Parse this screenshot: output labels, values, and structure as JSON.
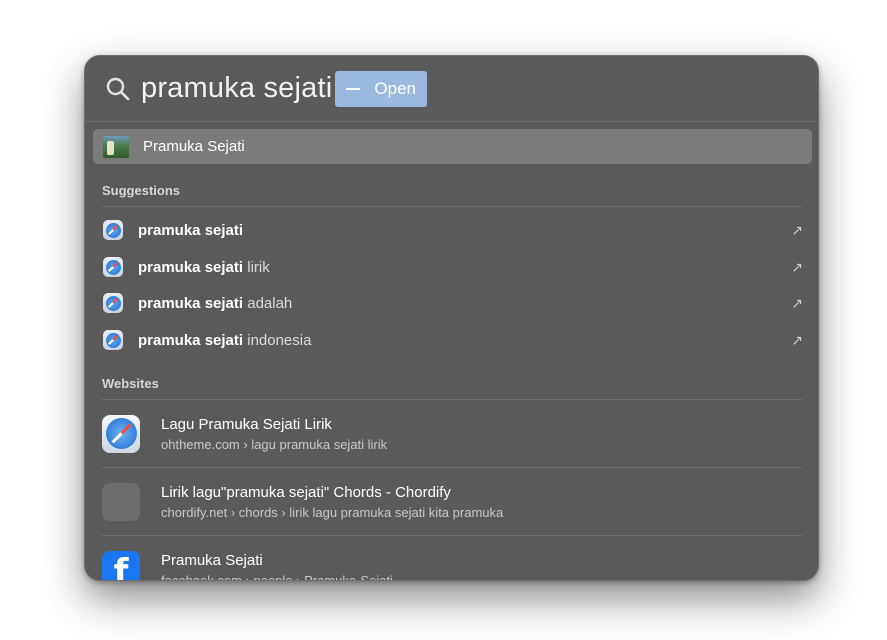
{
  "search": {
    "query": "pramuka sejati",
    "action_label": "Open"
  },
  "top_hit": {
    "label": "Pramuka Sejati"
  },
  "suggestions": {
    "header": "Suggestions",
    "items": [
      {
        "bold": "pramuka sejati",
        "rest": ""
      },
      {
        "bold": "pramuka sejati",
        "rest": " lirik"
      },
      {
        "bold": "pramuka sejati",
        "rest": " adalah"
      },
      {
        "bold": "pramuka sejati",
        "rest": " indonesia"
      }
    ],
    "arrow_glyph": "↗"
  },
  "websites": {
    "header": "Websites",
    "items": [
      {
        "icon": "safari-icon",
        "title": "Lagu Pramuka Sejati Lirik",
        "url": "ohtheme.com › lagu pramuka sejati lirik"
      },
      {
        "icon": "blank-site-icon",
        "title": "Lirik lagu\"pramuka sejati\" Chords - Chordify",
        "url": "chordify.net › chords › lirik lagu pramuka sejati kita pramuka"
      },
      {
        "icon": "facebook-icon",
        "title": "Pramuka Sejati",
        "url": "facebook.com › people › Pramuka-Sejati"
      }
    ]
  },
  "colors": {
    "panel": "#5a5a5a",
    "selection": "#7b7b7b",
    "action_chip": "#9bb9de",
    "facebook": "#1a77f2"
  }
}
